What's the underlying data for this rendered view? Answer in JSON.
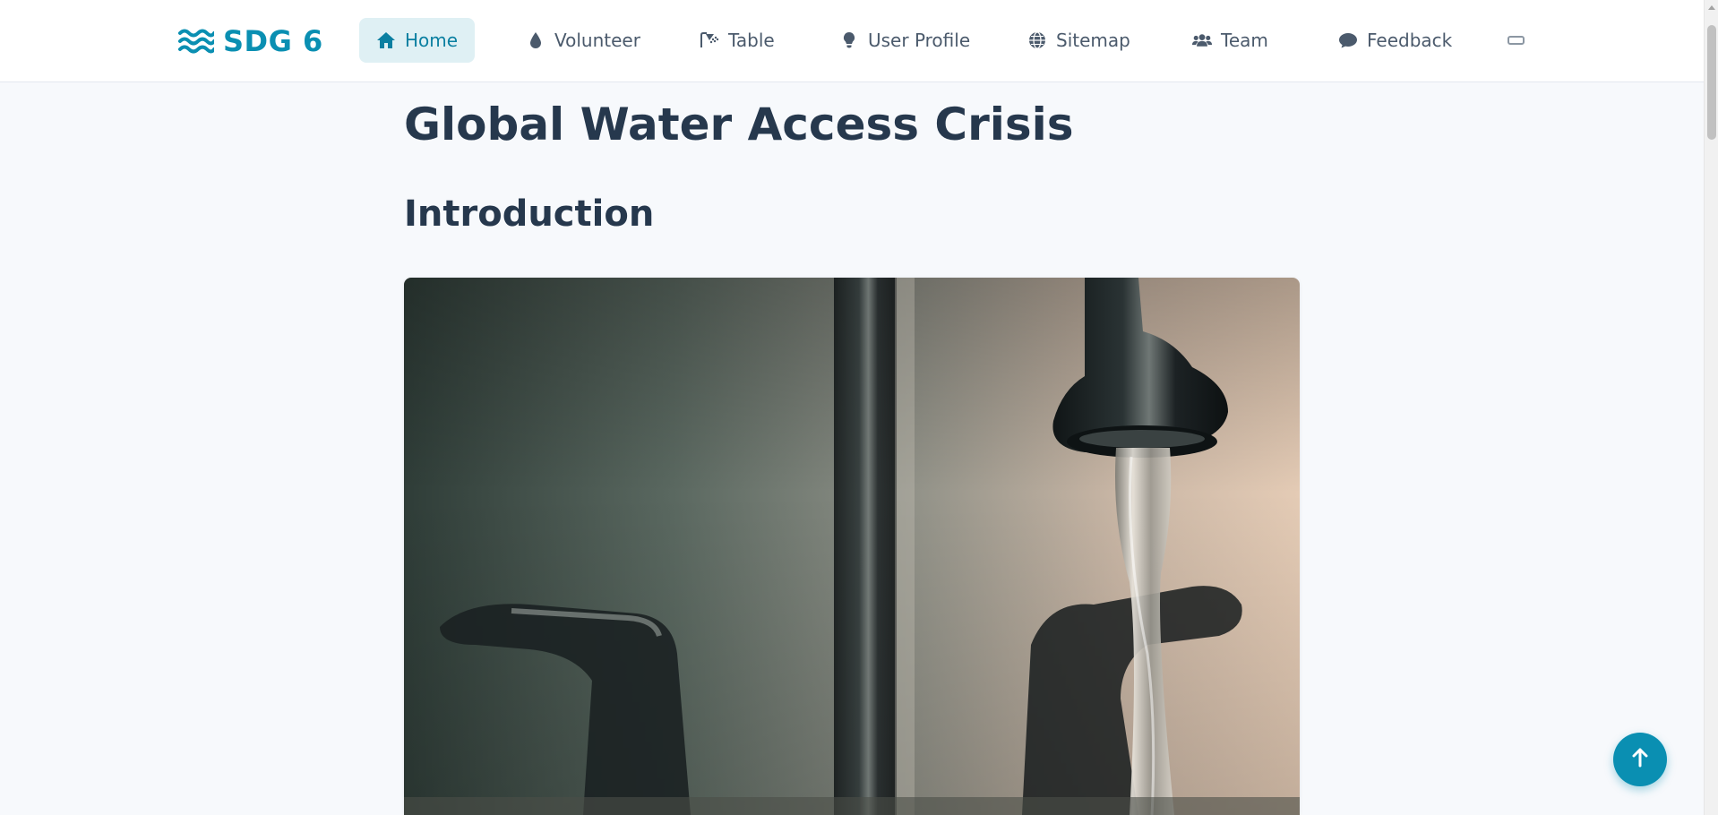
{
  "brand": {
    "logo_icon": "water-waves-icon",
    "name": "SDG 6"
  },
  "nav": {
    "items": [
      {
        "label": "Home",
        "icon": "home-icon",
        "active": true
      },
      {
        "label": "Volunteer",
        "icon": "droplet-icon",
        "active": false
      },
      {
        "label": "Table",
        "icon": "shower-icon",
        "active": false
      },
      {
        "label": "User Profile",
        "icon": "lightbulb-icon",
        "active": false
      },
      {
        "label": "Sitemap",
        "icon": "globe-icon",
        "active": false
      },
      {
        "label": "Team",
        "icon": "users-icon",
        "active": false
      },
      {
        "label": "Feedback",
        "icon": "comment-icon",
        "active": false
      }
    ],
    "menu_toggle_icon": "theme-toggle-icon"
  },
  "main": {
    "title": "Global Water Access Crisis",
    "section_title": "Introduction",
    "hero_image": "water-faucet-photo"
  },
  "back_to_top_icon": "arrow-up-icon",
  "colors": {
    "brand": "#0a8fb2",
    "active_nav_bg": "#dff0f4",
    "page_bg": "#f7f9fc",
    "heading": "#26384d"
  }
}
